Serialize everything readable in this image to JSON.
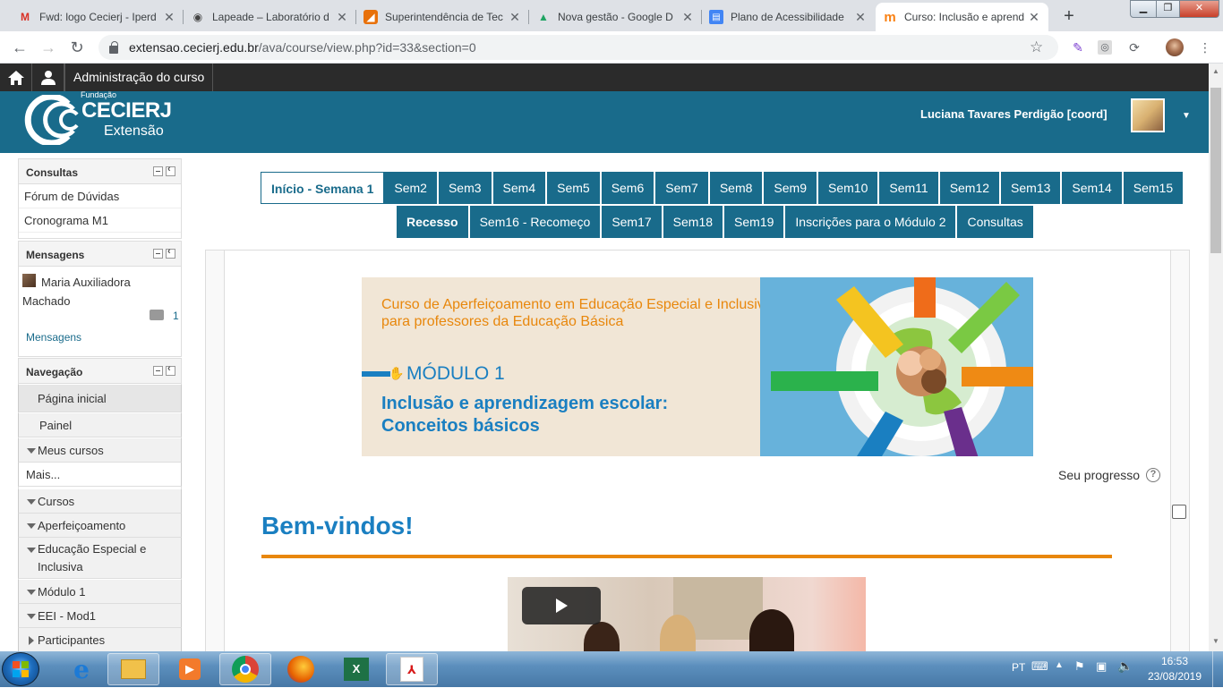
{
  "browser": {
    "tabs": [
      {
        "title": "Fwd: logo Cecierj - Iperd",
        "icon": "gmail-icon",
        "color": "#d93025",
        "glyph": "M"
      },
      {
        "title": "Lapeade – Laboratório d",
        "icon": "eye-icon",
        "color": "#444444",
        "glyph": "◉"
      },
      {
        "title": "Superintendência de Tec",
        "icon": "orange-app-icon",
        "color": "#e8710a",
        "glyph": "◢"
      },
      {
        "title": "Nova gestão - Google D",
        "icon": "google-drive-icon",
        "color": "#1fa463",
        "glyph": "▲"
      },
      {
        "title": "Plano de Acessibilidade",
        "icon": "google-docs-icon",
        "color": "#4285f4",
        "glyph": "▤"
      },
      {
        "title": "Curso: Inclusão e aprend",
        "icon": "moodle-icon",
        "color": "#f98012",
        "glyph": "m"
      }
    ],
    "new_tab": "+",
    "address_host": "extensao.cecierj.edu.br",
    "address_path": "/ava/course/view.php?id=33&section=0"
  },
  "moodle_nav": {
    "admin": "Administração do curso"
  },
  "header": {
    "logo_fundacao": "Fundação",
    "logo_name": "CECIERJ",
    "logo_sub": "Extensão",
    "user_name": "Luciana Tavares Perdigão [coord]"
  },
  "blocks": {
    "consultas": {
      "title": "Consultas",
      "items": [
        "Fórum de Dúvidas",
        "Cronograma M1"
      ]
    },
    "mensagens": {
      "title": "Mensagens",
      "contact": "Maria Auxiliadora Machado",
      "count": "1",
      "link": "Mensagens"
    },
    "navegacao": {
      "title": "Navegação",
      "items": [
        "Página inicial",
        "Painel",
        "Meus cursos",
        "Mais...",
        "Cursos",
        "Aperfeiçoamento",
        "Educação Especial e Inclusiva",
        "Módulo 1",
        "EEI - Mod1",
        "Participantes"
      ]
    }
  },
  "section_tabs": {
    "row1": [
      "Início - Semana 1",
      "Sem2",
      "Sem3",
      "Sem4",
      "Sem5",
      "Sem6",
      "Sem7",
      "Sem8",
      "Sem9",
      "Sem10",
      "Sem11",
      "Sem12",
      "Sem13",
      "Sem14",
      "Sem15"
    ],
    "row2": [
      "Recesso",
      "Sem16 - Recomeço",
      "Sem17",
      "Sem18",
      "Sem19",
      "Inscrições para o Módulo 2",
      "Consultas"
    ]
  },
  "banner": {
    "line1": "Curso de Aperfeiçoamento em Educação Especial e Inclusiva",
    "line2": "para professores da Educação Básica",
    "module": "MÓDULO 1",
    "title1": "Inclusão e aprendizagem escolar:",
    "title2": "Conceitos básicos"
  },
  "content": {
    "progress": "Seu progresso",
    "welcome": "Bem-vindos!"
  },
  "taskbar": {
    "lang": "PT",
    "time": "16:53",
    "date": "23/08/2019"
  },
  "colors": {
    "brand": "#196b8b",
    "accent": "#e8870c",
    "heading": "#1a7fc1"
  }
}
